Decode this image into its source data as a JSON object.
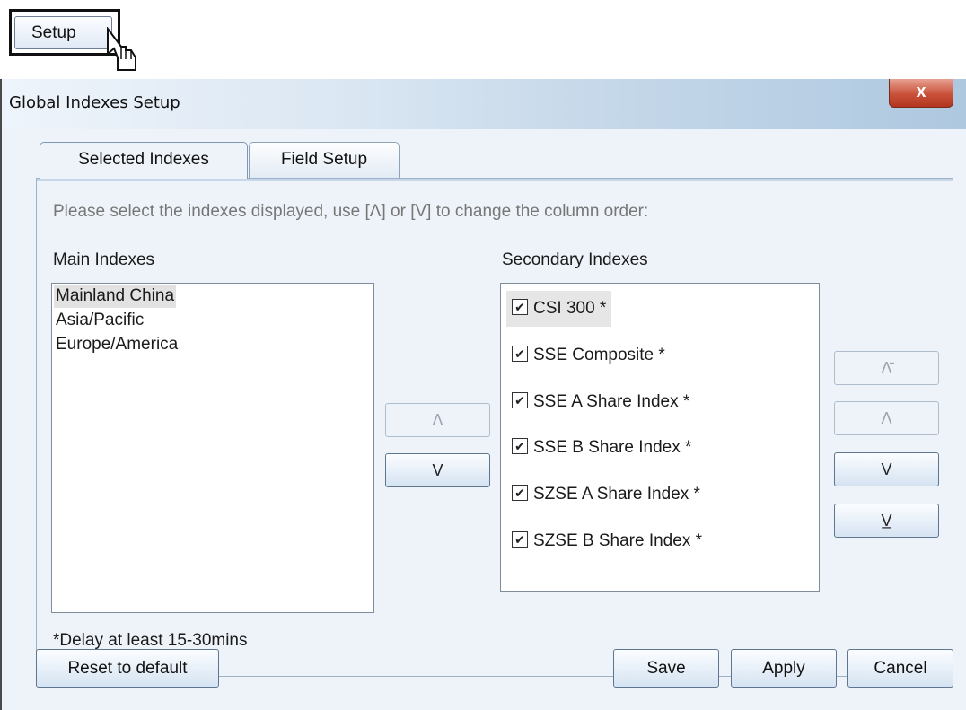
{
  "launcher": {
    "button_label": "Setup"
  },
  "dialog": {
    "title": "Global Indexes Setup",
    "close_glyph": "x",
    "tabs": [
      {
        "label": "Selected Indexes",
        "active": true
      },
      {
        "label": "Field Setup",
        "active": false
      }
    ],
    "instruction": "Please select the indexes displayed, use [Λ] or [V] to change the column order:",
    "main_indexes": {
      "label": "Main Indexes",
      "items": [
        {
          "label": "Mainland China",
          "selected": true
        },
        {
          "label": "Asia/Pacific",
          "selected": false
        },
        {
          "label": "Europe/America",
          "selected": false
        }
      ],
      "move_up_glyph": "Λ",
      "move_down_glyph": "V"
    },
    "secondary_indexes": {
      "label": "Secondary Indexes",
      "items": [
        {
          "label": "CSI 300 *",
          "checked": true,
          "selected": true
        },
        {
          "label": "SSE Composite *",
          "checked": true,
          "selected": false
        },
        {
          "label": "SSE A Share Index *",
          "checked": true,
          "selected": false
        },
        {
          "label": "SSE B Share Index *",
          "checked": true,
          "selected": false
        },
        {
          "label": "SZSE A Share Index *",
          "checked": true,
          "selected": false
        },
        {
          "label": "SZSE B Share Index *",
          "checked": true,
          "selected": false
        }
      ],
      "check_glyph": "✔",
      "move_top_glyph": "Λ̄",
      "move_up_glyph": "Λ",
      "move_down_glyph": "V",
      "move_bottom_glyph": "V̲"
    },
    "note": "*Delay at least 15-30mins",
    "buttons": {
      "reset": "Reset to default",
      "save": "Save",
      "apply": "Apply",
      "cancel": "Cancel"
    }
  },
  "colors": {
    "client_bg": "#eef3f9",
    "close_button": "#c9513a",
    "button_border": "#5f7690",
    "disabled_text": "#9aa3ad"
  }
}
